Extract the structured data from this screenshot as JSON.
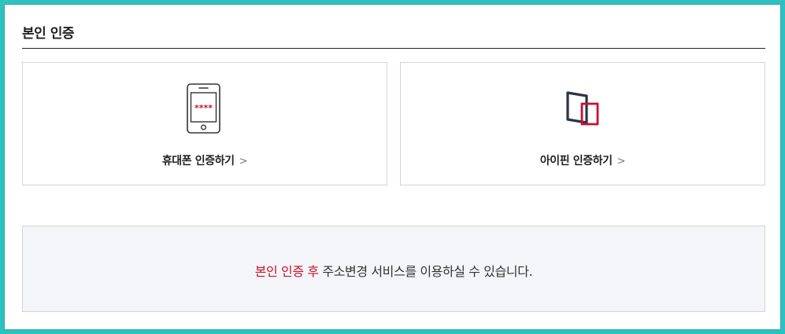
{
  "section": {
    "title": "본인 인증"
  },
  "options": [
    {
      "label": "휴대폰 인증하기",
      "icon": "mobile-phone-icon",
      "masked_code": "****",
      "chevron": ">"
    },
    {
      "label": "아이핀 인증하기",
      "icon": "ipin-icon",
      "chevron": ">"
    }
  ],
  "notice": {
    "highlight": "본인 인증 후",
    "text": " 주소변경 서비스를 이용하실 수 있습니다."
  },
  "colors": {
    "accent_red": "#c8102e",
    "frame_teal": "#2ec1bf",
    "ipin_navy": "#2b3548",
    "notice_bg": "#f4f5f8"
  }
}
